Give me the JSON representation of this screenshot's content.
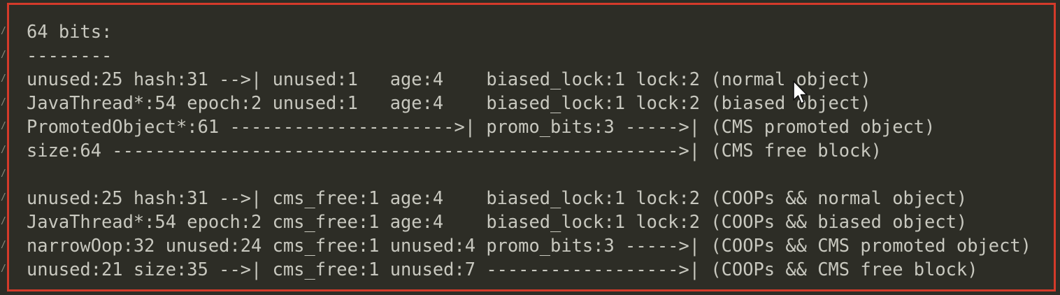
{
  "editor": {
    "gutter_mark": "/",
    "lines": [
      "64 bits:",
      "--------",
      "unused:25 hash:31 -->| unused:1   age:4    biased_lock:1 lock:2 (normal object)",
      "JavaThread*:54 epoch:2 unused:1   age:4    biased_lock:1 lock:2 (biased object)",
      "PromotedObject*:61 --------------------->| promo_bits:3 ----->| (CMS promoted object)",
      "size:64 ----------------------------------------------------->| (CMS free block)",
      "",
      "unused:25 hash:31 -->| cms_free:1 age:4    biased_lock:1 lock:2 (COOPs && normal object)",
      "JavaThread*:54 epoch:2 cms_free:1 age:4    biased_lock:1 lock:2 (COOPs && biased object)",
      "narrowOop:32 unused:24 cms_free:1 unused:4 promo_bits:3 ----->| (COOPs && CMS promoted object)",
      "unused:21 size:35 -->| cms_free:1 unused:7 ------------------>| (COOPs && CMS free block)"
    ]
  },
  "colors": {
    "background": "#2d2d26",
    "text": "#c8c8bf",
    "highlight_border": "#d43a2a"
  },
  "icons": {
    "cursor": "mouse-pointer-icon"
  }
}
